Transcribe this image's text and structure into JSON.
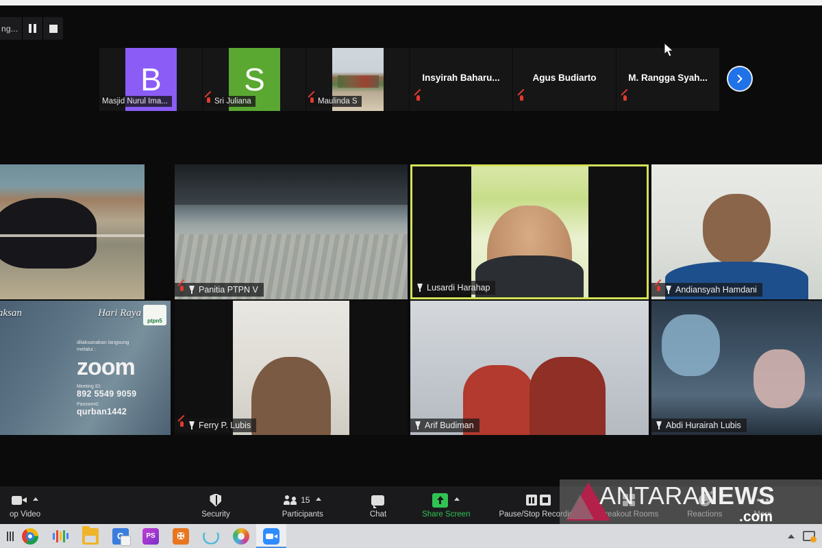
{
  "app": {
    "name": "Zoom Meeting",
    "recording_bar": {
      "label": "ng...",
      "pause_title": "Pause Recording",
      "stop_title": "Stop Recording"
    }
  },
  "filmstrip": {
    "next_page_icon": "chevron-right-icon",
    "participants": [
      {
        "name": "Masjid Nurul Ima...",
        "avatar_initial": "B",
        "avatar_color": "#8b5cf6",
        "kind": "avatar",
        "muted": false
      },
      {
        "name": "Sri Juliana",
        "avatar_initial": "S",
        "avatar_color": "#5aa832",
        "kind": "avatar",
        "muted": true
      },
      {
        "name": "Maulinda S",
        "avatar_initial": "",
        "avatar_color": "",
        "kind": "photo",
        "muted": true
      },
      {
        "name": "Insyirah  Baharu...",
        "avatar_initial": "",
        "avatar_color": "",
        "kind": "name-only",
        "muted": true
      },
      {
        "name": "Agus Budiarto",
        "avatar_initial": "",
        "avatar_color": "",
        "kind": "name-only",
        "muted": true
      },
      {
        "name": "M.  Rangga  Syah...",
        "avatar_initial": "",
        "avatar_color": "",
        "kind": "name-only",
        "muted": true
      }
    ]
  },
  "grid": {
    "active_border_color": "#d4e157",
    "tiles": [
      {
        "name": "",
        "scene": "sc-cow",
        "muted": false,
        "pinned": false,
        "active": false,
        "has_label": false
      },
      {
        "name": "Panitia PTPN V",
        "scene": "sc-courtyard",
        "muted": true,
        "pinned": true,
        "active": false,
        "has_label": true
      },
      {
        "name": "Lusardi Harahap",
        "scene": "sc-lusardi",
        "muted": false,
        "pinned": true,
        "active": true,
        "has_label": true
      },
      {
        "name": "Andiansyah Hamdani",
        "scene": "sc-andiansyah",
        "muted": true,
        "pinned": true,
        "active": false,
        "has_label": true
      },
      {
        "name": "",
        "scene": "sc-slide",
        "muted": false,
        "pinned": false,
        "active": false,
        "has_label": false
      },
      {
        "name": "Ferry P. Lubis",
        "scene": "sc-ferry",
        "muted": true,
        "pinned": true,
        "active": false,
        "has_label": true
      },
      {
        "name": "Arif Budiman",
        "scene": "sc-arif",
        "muted": false,
        "pinned": true,
        "active": false,
        "has_label": true
      },
      {
        "name": "Abdi Hurairah Lubis",
        "scene": "sc-abdi",
        "muted": false,
        "pinned": true,
        "active": false,
        "has_label": true
      }
    ]
  },
  "slide": {
    "script_left": "elaksan",
    "script_right": "Hari Raya",
    "logo_text": "ptpn5",
    "line1": "dilaksanakan langsung",
    "line2": "melalui :",
    "brand": "zoom",
    "meeting_id_label": "Meeting ID:",
    "meeting_id_value": "892 5549 9059",
    "password_label": "Password:",
    "password_value": "qurban1442"
  },
  "toolbar": {
    "video": {
      "label": "op Video",
      "icon": "video-camera-icon",
      "has_caret": true
    },
    "security": {
      "label": "Security",
      "icon": "shield-icon",
      "has_caret": false
    },
    "participants": {
      "label": "Participants",
      "icon": "people-icon",
      "count": "15",
      "has_caret": true
    },
    "chat": {
      "label": "Chat",
      "icon": "chat-bubble-icon",
      "has_caret": false
    },
    "share_screen": {
      "label": "Share Screen",
      "icon": "share-screen-icon",
      "has_caret": true,
      "color": "#31c254"
    },
    "recording": {
      "label": "Pause/Stop Recording",
      "icon": "pause-stop-recording-icon",
      "has_caret": false
    },
    "breakout": {
      "label": "Breakout Rooms",
      "icon": "grid-squares-icon",
      "has_caret": false
    },
    "reactions": {
      "label": "Reactions",
      "icon": "smiley-plus-icon",
      "has_caret": false
    },
    "more": {
      "label": "More",
      "icon": "ellipsis-icon",
      "has_caret": false
    }
  },
  "watermark": {
    "text_main": "ANTARA",
    "text_bold": "NEWS",
    "text_sub": ".com",
    "triangle_color": "#b3204a"
  },
  "taskbar": {
    "items": [
      {
        "name": "Google Chrome",
        "icon": "chrome-icon",
        "active": false
      },
      {
        "name": "Audacity",
        "icon": "audio-waveform-icon",
        "active": false
      },
      {
        "name": "File Explorer",
        "icon": "folder-icon",
        "active": false
      },
      {
        "name": "Google Translate",
        "icon": "google-translate-icon",
        "active": false
      },
      {
        "name": "PhotoScape",
        "icon": "photoscape-icon",
        "active": false
      },
      {
        "name": "XMind",
        "icon": "xmind-icon",
        "active": false
      },
      {
        "name": "Cloud App",
        "icon": "cloud-icon",
        "active": false
      },
      {
        "name": "Photos",
        "icon": "photos-icon",
        "active": false
      },
      {
        "name": "Zoom",
        "icon": "zoom-icon",
        "active": true
      }
    ],
    "tray": {
      "show_hidden": "show-hidden-icons-caret",
      "notifications": "notification-icon"
    }
  }
}
